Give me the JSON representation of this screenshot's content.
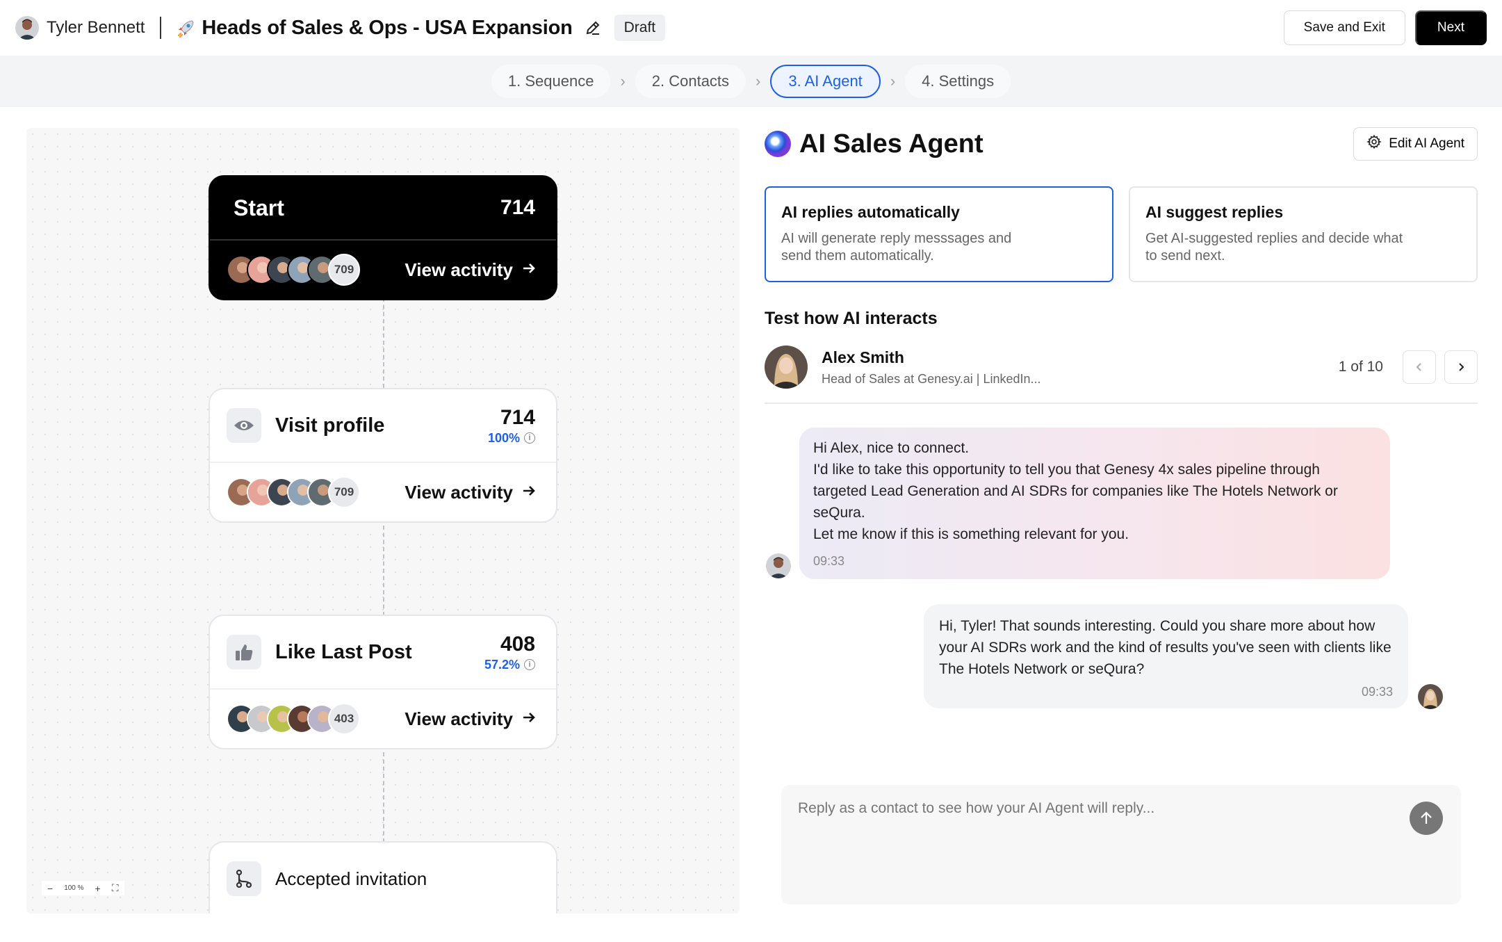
{
  "header": {
    "user_name": "Tyler Bennett",
    "campaign_title": "Heads of Sales & Ops - USA Expansion",
    "status_badge": "Draft",
    "save_exit_label": "Save and Exit",
    "next_label": "Next"
  },
  "steps": [
    "1. Sequence",
    "2. Contacts",
    "3. AI Agent",
    "4. Settings"
  ],
  "active_step": "3. AI Agent",
  "workflow": {
    "start": {
      "title": "Start",
      "count": "714",
      "avatar_count": "709",
      "action": "View activity"
    },
    "visit": {
      "title": "Visit profile",
      "count": "714",
      "percent": "100%",
      "avatar_count": "709",
      "action": "View activity"
    },
    "like": {
      "title": "Like Last Post",
      "count": "408",
      "percent": "57.2%",
      "avatar_count": "403",
      "action": "View activity"
    },
    "accepted": {
      "title": "Accepted invitation"
    },
    "zoom": "100 %"
  },
  "agent": {
    "title": "AI Sales Agent",
    "edit_label": "Edit AI Agent",
    "modes": [
      {
        "title": "AI replies automatically",
        "desc": "AI will generate reply messsages and send them automatically."
      },
      {
        "title": "AI suggest replies",
        "desc": "Get AI-suggested replies and decide what to send next."
      }
    ],
    "test_title": "Test how AI interacts",
    "contact": {
      "name": "Alex Smith",
      "subtitle": "Head of Sales at Genesy.ai | LinkedIn..."
    },
    "pager": "1 of 10",
    "messages": {
      "outgoing": {
        "lines": [
          "Hi Alex, nice to connect.",
          "I'd like to take this opportunity to tell you that Genesy 4x sales pipeline through targeted Lead Generation and AI SDRs for companies like The Hotels Network or seQura.",
          "Let me know if this is something relevant for you."
        ],
        "time": "09:33"
      },
      "incoming": {
        "text": "Hi, Tyler! That sounds interesting. Could you share more about how your AI SDRs work and the kind of results you've seen with clients like The Hotels Network or seQura?",
        "time": "09:33"
      }
    },
    "reply_placeholder": "Reply as a contact to see how your AI Agent will reply..."
  },
  "colors": {
    "accent": "#1d5fe6",
    "dark": "#000000"
  }
}
